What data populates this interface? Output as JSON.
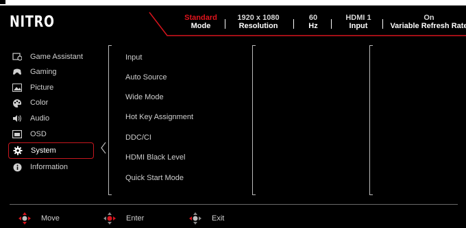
{
  "brand": {
    "logo": "NITRO",
    "accent": "#d7141d"
  },
  "status": [
    {
      "value": "Standard",
      "label": "Mode",
      "highlight": true
    },
    {
      "value": "1920 x 1080",
      "label": "Resolution",
      "highlight": false
    },
    {
      "value": "60",
      "label": "Hz",
      "highlight": false
    },
    {
      "value": "HDMI 1",
      "label": "Input",
      "highlight": false
    },
    {
      "value": "On",
      "label": "Variable Refresh Rate",
      "highlight": false
    }
  ],
  "menu": [
    {
      "label": "Game Assistant",
      "icon": "game-assistant-icon"
    },
    {
      "label": "Gaming",
      "icon": "gamepad-icon"
    },
    {
      "label": "Picture",
      "icon": "picture-icon"
    },
    {
      "label": "Color",
      "icon": "palette-icon"
    },
    {
      "label": "Audio",
      "icon": "speaker-icon"
    },
    {
      "label": "OSD",
      "icon": "osd-icon"
    },
    {
      "label": "System",
      "icon": "gear-icon",
      "active": true
    },
    {
      "label": "Information",
      "icon": "info-icon"
    }
  ],
  "system_items": [
    "Input",
    "Auto Source",
    "Wide Mode",
    "Hot Key Assignment",
    "DDC/CI",
    "HDMI Black Level",
    "Quick Start Mode"
  ],
  "footer": [
    {
      "label": "Move",
      "icon": "move-dpad-icon"
    },
    {
      "label": "Enter",
      "icon": "enter-dpad-icon"
    },
    {
      "label": "Exit",
      "icon": "exit-dpad-icon"
    }
  ]
}
